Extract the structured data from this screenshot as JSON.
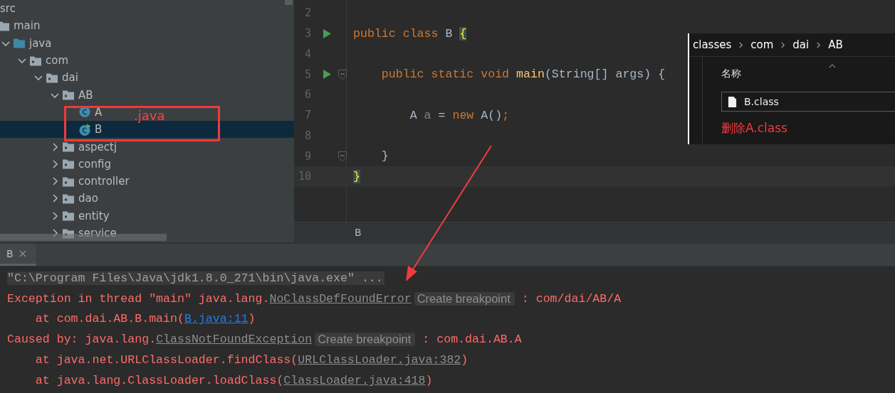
{
  "project_tree": {
    "items": [
      {
        "label": "src",
        "selected": false,
        "children": [
          {
            "label": "main",
            "kind": "folder",
            "selected": false,
            "children": [
              {
                "label": "java",
                "kind": "source-root",
                "expanded": true,
                "selected": false,
                "children": [
                  {
                    "label": "com",
                    "kind": "package",
                    "expanded": true,
                    "selected": false,
                    "children": [
                      {
                        "label": "dai",
                        "kind": "package",
                        "expanded": true,
                        "selected": false,
                        "children": [
                          {
                            "label": "AB",
                            "kind": "package",
                            "expanded": true,
                            "selected": false,
                            "children": [
                              {
                                "label": "A",
                                "kind": "class",
                                "selected": false
                              },
                              {
                                "label": "B",
                                "kind": "main-class",
                                "selected": true
                              }
                            ]
                          },
                          {
                            "label": "aspectj",
                            "kind": "package",
                            "expanded": false,
                            "selected": false
                          },
                          {
                            "label": "config",
                            "kind": "package",
                            "expanded": false,
                            "selected": false
                          },
                          {
                            "label": "controller",
                            "kind": "package",
                            "expanded": false,
                            "selected": false
                          },
                          {
                            "label": "dao",
                            "kind": "package",
                            "expanded": false,
                            "selected": false
                          },
                          {
                            "label": "entity",
                            "kind": "package",
                            "expanded": false,
                            "selected": false
                          },
                          {
                            "label": "service",
                            "kind": "package",
                            "expanded": false,
                            "selected": false
                          }
                        ]
                      }
                    ]
                  }
                ]
              }
            ]
          }
        ]
      }
    ],
    "note": ".java"
  },
  "editor": {
    "lines": [
      {
        "number": "2",
        "kind": "blank"
      },
      {
        "number": "3",
        "kind": "class",
        "run": true,
        "tokens": [
          {
            "kind": "keyword",
            "text": "public class "
          },
          {
            "kind": "plain",
            "text": "B "
          },
          {
            "kind": "brace",
            "text": "{"
          }
        ]
      },
      {
        "number": "4",
        "kind": "blank"
      },
      {
        "number": "5",
        "kind": "member",
        "run": true,
        "fold": true,
        "tokens": [
          {
            "kind": "keyword",
            "text": "public static void "
          },
          {
            "kind": "method",
            "text": "main"
          },
          {
            "kind": "plain",
            "text": "(String[] args) {"
          }
        ]
      },
      {
        "number": "6",
        "kind": "blank"
      },
      {
        "number": "7",
        "kind": "statement",
        "tokens": [
          {
            "kind": "plain",
            "text": "A "
          },
          {
            "kind": "unused",
            "text": "a"
          },
          {
            "kind": "plain",
            "text": " = "
          },
          {
            "kind": "keyword",
            "text": "new "
          },
          {
            "kind": "plain",
            "text": "A()"
          },
          {
            "kind": "keyword",
            "text": ";"
          }
        ]
      },
      {
        "number": "8",
        "kind": "blank"
      },
      {
        "number": "9",
        "kind": "member",
        "fold": true,
        "tokens": [
          {
            "kind": "plain",
            "text": "}"
          }
        ]
      },
      {
        "number": "10",
        "kind": "class",
        "current": true,
        "tokens": [
          {
            "kind": "brace",
            "text": "}"
          }
        ]
      }
    ],
    "breadcrumb": "B"
  },
  "explorer": {
    "path": [
      "classes",
      "com",
      "dai",
      "AB"
    ],
    "column": "名称",
    "files": [
      "B.class"
    ],
    "note": "删除A.class"
  },
  "run_panel": {
    "tabs": [
      {
        "label": "B",
        "selected": true
      }
    ],
    "console": [
      {
        "kind": "message",
        "segments": [
          {
            "kind": "command",
            "text": "\"C:\\Program Files\\Java\\jdk1.8.0_271\\bin\\java.exe\" ..."
          }
        ]
      },
      {
        "kind": "message",
        "segments": [
          {
            "kind": "error",
            "text": "Exception in thread \"main\" java.lang."
          },
          {
            "kind": "link",
            "text": "NoClassDefFoundError"
          },
          {
            "kind": "chip",
            "text": "Create breakpoint"
          },
          {
            "kind": "error",
            "text": " : com/dai/AB/A"
          }
        ]
      },
      {
        "kind": "frame",
        "segments": [
          {
            "kind": "error",
            "text": "at com.dai.AB.B.main("
          },
          {
            "kind": "source",
            "text": "B.java:11"
          },
          {
            "kind": "error",
            "text": ")"
          }
        ]
      },
      {
        "kind": "message",
        "segments": [
          {
            "kind": "error",
            "text": "Caused by: java.lang."
          },
          {
            "kind": "link",
            "text": "ClassNotFoundException"
          },
          {
            "kind": "chip",
            "text": "Create breakpoint"
          },
          {
            "kind": "error",
            "text": " : com.dai.AB.A"
          }
        ]
      },
      {
        "kind": "frame",
        "segments": [
          {
            "kind": "error",
            "text": "at java.net.URLClassLoader.findClass("
          },
          {
            "kind": "link",
            "text": "URLClassLoader.java:382"
          },
          {
            "kind": "error",
            "text": ")"
          }
        ]
      },
      {
        "kind": "frame",
        "segments": [
          {
            "kind": "error",
            "text": "at java.lang.ClassLoader.loadClass("
          },
          {
            "kind": "link",
            "text": "ClassLoader.java:418"
          },
          {
            "kind": "error",
            "text": ")"
          }
        ]
      }
    ]
  }
}
